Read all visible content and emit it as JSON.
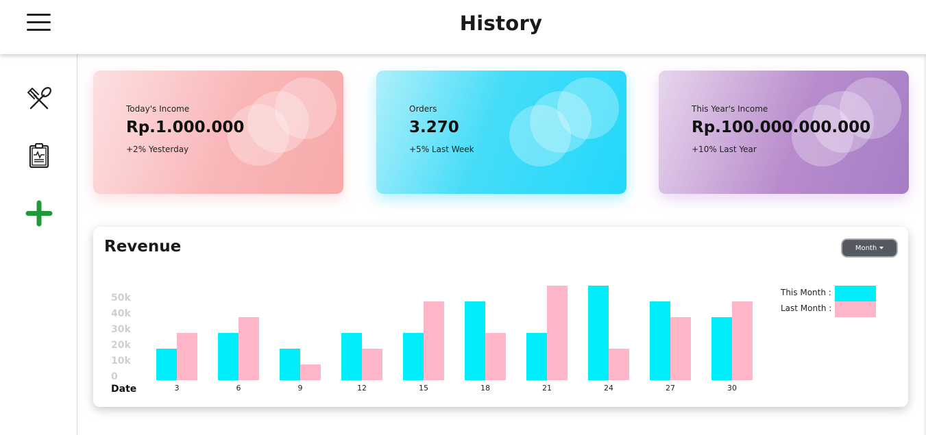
{
  "header": {
    "title": "History"
  },
  "sidebar": {
    "items": [
      {
        "icon": "utensils-icon"
      },
      {
        "icon": "clipboard-icon"
      },
      {
        "icon": "plus-icon"
      }
    ]
  },
  "cards": [
    {
      "label": "Today's Income",
      "value": "Rp.1.000.000",
      "sub": "+2% Yesterday"
    },
    {
      "label": "Orders",
      "value": "3.270",
      "sub": "+5% Last Week"
    },
    {
      "label": "This Year's Income",
      "value": "Rp.100.000.000.000",
      "sub": "+10% Last Year"
    }
  ],
  "revenue": {
    "title": "Revenue",
    "period_button": "Month"
  },
  "colors": {
    "this_month": "#00eefa",
    "last_month": "#ffb6c8",
    "add_green": "#1e9a3a"
  },
  "chart_data": {
    "type": "bar",
    "categories": [
      "3",
      "6",
      "9",
      "12",
      "15",
      "18",
      "21",
      "24",
      "27",
      "30"
    ],
    "series": [
      {
        "name": "This Month :",
        "values": [
          20,
          30,
          20,
          30,
          30,
          50,
          30,
          60,
          50,
          40
        ]
      },
      {
        "name": "Last Month :",
        "values": [
          30,
          40,
          10,
          20,
          50,
          30,
          60,
          20,
          40,
          50
        ]
      }
    ],
    "ytick_labels": [
      "0",
      "10k",
      "20k",
      "30k",
      "40k",
      "50k"
    ],
    "yticks": [
      0,
      10,
      20,
      30,
      40,
      50
    ],
    "ylim": [
      0,
      60
    ],
    "xlabel": "Date",
    "legend": "right",
    "grid": false
  }
}
